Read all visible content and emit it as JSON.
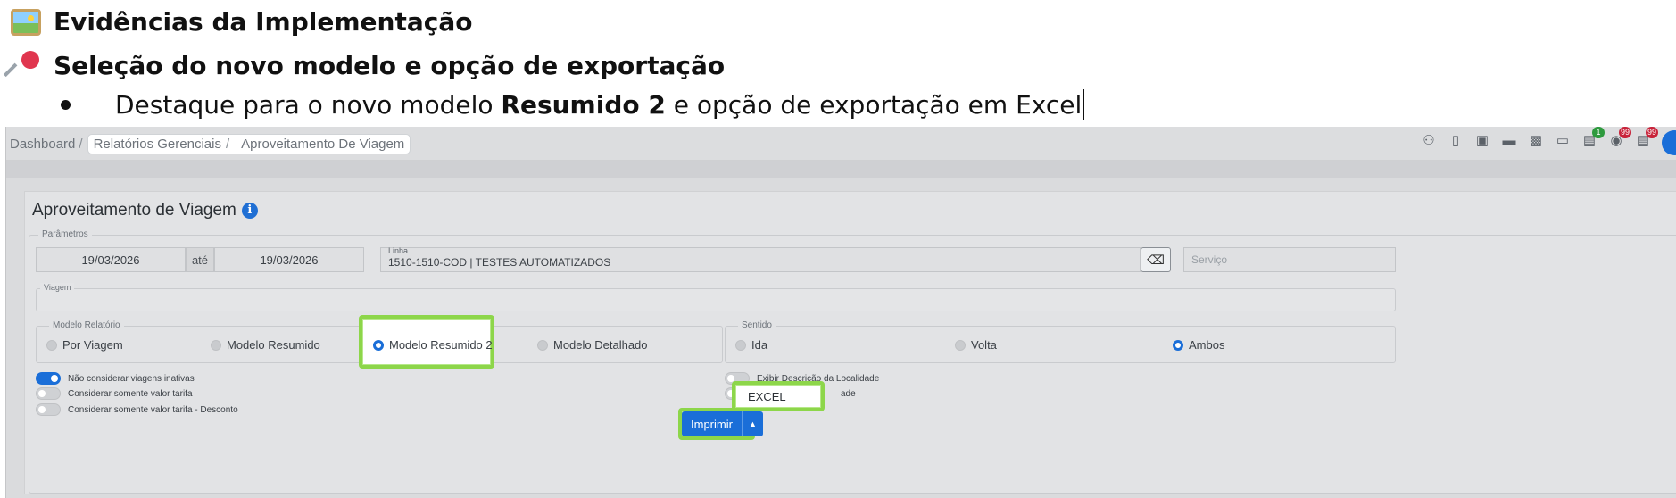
{
  "doc": {
    "heading1": "Evidências da Implementação",
    "heading2": "Seleção do novo modelo e opção de exportação",
    "bullet_pre": "Destaque para o novo modelo ",
    "bullet_bold": "Resumido 2",
    "bullet_post": " e opção de exportação em Excel"
  },
  "breadcrumb": {
    "dashboard": "Dashboard",
    "sep1": "/",
    "reports": "Relatórios Gerenciais",
    "sep2": "/",
    "current": "Aproveitamento De Viagem"
  },
  "topbar_icons": [
    {
      "icon": "user-key-icon"
    },
    {
      "icon": "mobile-icon"
    },
    {
      "icon": "rss-card-icon"
    },
    {
      "icon": "ticket-icon"
    },
    {
      "icon": "save-icon"
    },
    {
      "icon": "monitor-icon"
    },
    {
      "icon": "inbox-icon",
      "badge": "1",
      "badge_color": "#2e9a3e"
    },
    {
      "icon": "dollar-icon",
      "badge": "99",
      "badge_color": "#c8233a"
    },
    {
      "icon": "document-icon",
      "badge": "99",
      "badge_color": "#c8233a"
    }
  ],
  "panel": {
    "title": "Aproveitamento de Viagem",
    "info": "i"
  },
  "params": {
    "legend": "Parâmetros",
    "date_from": "19/03/2026",
    "until_label": "até",
    "date_to": "19/03/2026",
    "linha_label": "Linha",
    "linha_value": "1510-1510-COD | TESTES AUTOMATIZADOS",
    "servico_placeholder": "Serviço",
    "viagem_label": "Viagem"
  },
  "modelo": {
    "legend": "Modelo Relatório",
    "options": [
      "Por Viagem",
      "Modelo Resumido",
      "Modelo Resumido 2",
      "Modelo Detalhado"
    ],
    "selected": "Modelo Resumido 2"
  },
  "sentido": {
    "legend": "Sentido",
    "options": [
      "Ida",
      "Volta",
      "Ambos"
    ],
    "selected": "Ambos"
  },
  "toggles_left": [
    {
      "label": "Não considerar viagens inativas",
      "on": true
    },
    {
      "label": "Considerar somente valor tarifa",
      "on": false
    },
    {
      "label": "Considerar somente valor tarifa - Desconto",
      "on": false
    }
  ],
  "toggles_right": [
    {
      "label": "Exibir Descrição da Localidade",
      "on": false
    },
    {
      "label": "ade",
      "on": false
    }
  ],
  "print": {
    "label": "Imprimir",
    "caret": "▲",
    "menu_option": "EXCEL"
  },
  "colors": {
    "accent": "#1a6ed8",
    "highlight": "#8dd64a"
  }
}
